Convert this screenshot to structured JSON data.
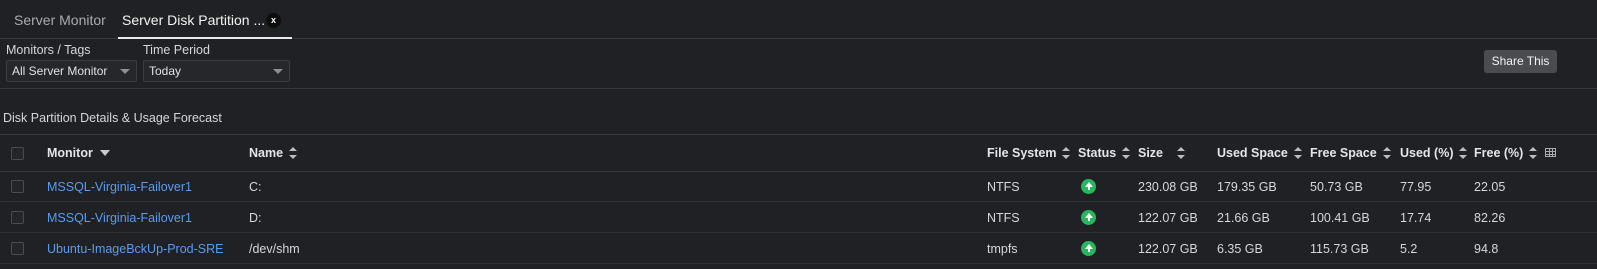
{
  "tabs": [
    {
      "label": "Server Monitor"
    },
    {
      "label": "Server Disk Partition ...",
      "close_label": "x"
    }
  ],
  "filters": {
    "monitors_label": "Monitors / Tags",
    "monitors_value": "All Server Monitor",
    "time_label": "Time Period",
    "time_value": "Today"
  },
  "share_label": "Share This",
  "section_title": "Disk Partition Details & Usage Forecast",
  "table": {
    "headers": {
      "monitor": "Monitor",
      "name": "Name",
      "file_system": "File System",
      "status": "Status",
      "size": "Size",
      "used_space": "Used Space",
      "free_space": "Free Space",
      "used_pct": "Used (%)",
      "free_pct": "Free (%)"
    },
    "rows": [
      {
        "monitor": "MSSQL-Virginia-Failover1",
        "name": "C:",
        "file_system": "NTFS",
        "status": "up",
        "size": "230.08 GB",
        "used_space": "179.35 GB",
        "free_space": "50.73 GB",
        "used_pct": "77.95",
        "free_pct": "22.05"
      },
      {
        "monitor": "MSSQL-Virginia-Failover1",
        "name": "D:",
        "file_system": "NTFS",
        "status": "up",
        "size": "122.07 GB",
        "used_space": "21.66 GB",
        "free_space": "100.41 GB",
        "used_pct": "17.74",
        "free_pct": "82.26"
      },
      {
        "monitor": "Ubuntu-ImageBckUp-Prod-SRE",
        "name": "/dev/shm",
        "file_system": "tmpfs",
        "status": "up",
        "size": "122.07 GB",
        "used_space": "6.35 GB",
        "free_space": "115.73 GB",
        "used_pct": "5.2",
        "free_pct": "94.8"
      }
    ]
  },
  "colors": {
    "background": "#202124",
    "link": "#5b9bf0",
    "status_up": "#27b75e",
    "share_button": "#4a4c50"
  }
}
